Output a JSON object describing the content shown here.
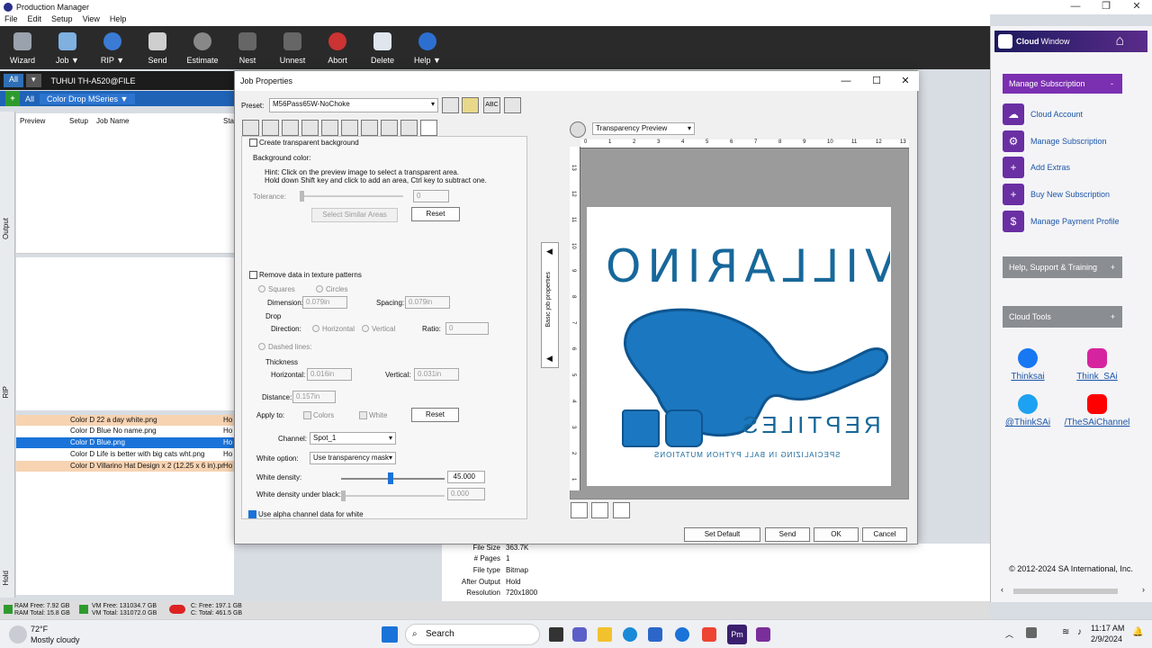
{
  "app": {
    "title": "Production Manager",
    "window_controls": {
      "minimize": "—",
      "maximize": "❐",
      "close": "✕"
    }
  },
  "menu": [
    "File",
    "Edit",
    "Setup",
    "View",
    "Help"
  ],
  "toolbar": [
    {
      "label": "Wizard",
      "icon": "wizard-icon"
    },
    {
      "label": "Job ▼",
      "icon": "job-folder-icon"
    },
    {
      "label": "RIP ▼",
      "icon": "rip-globe-icon"
    },
    {
      "label": "Send",
      "icon": "printer-icon"
    },
    {
      "label": "Estimate",
      "icon": "estimate-icon"
    },
    {
      "label": "Nest",
      "icon": "nest-icon"
    },
    {
      "label": "Unnest",
      "icon": "unnest-icon"
    },
    {
      "label": "Abort",
      "icon": "abort-icon"
    },
    {
      "label": "Delete",
      "icon": "delete-icon"
    },
    {
      "label": "Help ▼",
      "icon": "help-icon"
    }
  ],
  "queue": {
    "all_tab": "All",
    "device": "TUHUI TH-A520@FILE",
    "filter_all": "All",
    "filter_drop": "Color Drop MSeries ▼"
  },
  "list_headers": {
    "preview": "Preview",
    "setup": "Setup",
    "job_name": "Job Name",
    "status": "Sta"
  },
  "side_labels": {
    "output": "Output",
    "rip": "RIP",
    "hold": "Hold"
  },
  "hold_jobs": [
    {
      "setup": "Color D",
      "name": "22 a day white.png",
      "status": "Ho",
      "style": "orange"
    },
    {
      "setup": "Color D",
      "name": "Blue No name.png",
      "status": "Ho",
      "style": "plain"
    },
    {
      "setup": "Color D",
      "name": "Blue.png",
      "status": "Ho",
      "style": "selected"
    },
    {
      "setup": "Color D",
      "name": "Life is better with big cats wht.png",
      "status": "Ho",
      "style": "plain"
    },
    {
      "setup": "Color D",
      "name": "Villarino Hat Design x 2 (12.25 x 6 in).pr",
      "status": "Ho",
      "style": "orange"
    }
  ],
  "details": [
    {
      "k": "File Size",
      "v": "363.7K"
    },
    {
      "k": "# Pages",
      "v": "1"
    },
    {
      "k": "File type",
      "v": "Bitmap"
    },
    {
      "k": "After Output",
      "v": "Hold"
    },
    {
      "k": "Resolution",
      "v": "720x1800"
    }
  ],
  "status": {
    "ram_free": "RAM Free: 7.92 GB",
    "ram_total": "RAM Total: 15.8 GB",
    "vm_free": "VM Free: 131034.7 GB",
    "vm_total": "VM Total: 131072.0 GB",
    "c_free": "C: Free: 197.1 GB",
    "c_total": "C: Total: 461.5 GB"
  },
  "dialog": {
    "title": "Job Properties",
    "preset_label": "Preset:",
    "preset_value": "M56Pass65W-NoChoke",
    "create_transparent": "Create transparent background",
    "bg_color_label": "Background color:",
    "hint": "Hint: Click on the preview image to select a transparent area.",
    "hint2": "Hold down Shift key and click to add an area, Ctrl key to subtract one.",
    "tolerance_label": "Tolerance:",
    "tolerance_value": "0",
    "select_similar": "Select Similar Areas",
    "reset": "Reset",
    "remove_texture": "Remove data in texture patterns",
    "squares": "Squares",
    "circles": "Circles",
    "dimension_label": "Dimension:",
    "dimension_value": "0.079in",
    "spacing_label": "Spacing:",
    "spacing_value": "0.079in",
    "drop_label": "Drop",
    "direction_label": "Direction:",
    "horizontal": "Horizontal",
    "vertical": "Vertical",
    "ratio_label": "Ratio:",
    "ratio_value": "0",
    "dashed_lines": "Dashed lines:",
    "thickness_label": "Thickness",
    "thick_h_label": "Horizontal:",
    "thick_h_value": "0.016in",
    "thick_v_label": "Vertical:",
    "thick_v_value": "0.031in",
    "distance_label": "Distance:",
    "distance_value": "0.157in",
    "apply_to": "Apply to:",
    "colors": "Colors",
    "white": "White",
    "reset2": "Reset",
    "channel_label": "Channel:",
    "channel_value": "Spot_1",
    "white_option_label": "White option:",
    "white_option_value": "Use transparency mask",
    "white_density_label": "White density:",
    "white_density_value": "45.000",
    "white_density_fraction": 0.45,
    "white_under_black_label": "White density under black:",
    "white_under_black_value": "0.000",
    "use_alpha": "Use alpha channel data for white",
    "basic_props": "Basic job properties",
    "preview_mode": "Transparency Preview",
    "ruler_ticks": [
      "0",
      "1",
      "2",
      "3",
      "4",
      "5",
      "6",
      "7",
      "8",
      "9",
      "10",
      "11",
      "12",
      "13"
    ],
    "ruler_left_ticks": [
      "13",
      "12",
      "11",
      "10",
      "9",
      "8",
      "7",
      "6",
      "5",
      "4",
      "3",
      "2",
      "1"
    ],
    "buttons": {
      "set_default": "Set Default",
      "send": "Send",
      "ok": "OK",
      "cancel": "Cancel"
    },
    "art": {
      "title": "VILLARINO",
      "sub": "REPTILES",
      "tag": "SPECIALIZING IN BALL PYTHON MUTATIONS"
    }
  },
  "cloud": {
    "header_title": "Cloud",
    "header_sub": "Window",
    "manage_sub": "Manage Subscription",
    "links": [
      {
        "label": "Cloud Account",
        "icon": "cloud-account-icon"
      },
      {
        "label": "Manage Subscription",
        "icon": "manage-subscription-icon"
      },
      {
        "label": "Add Extras",
        "icon": "add-extras-icon"
      },
      {
        "label": "Buy New Subscription",
        "icon": "buy-subscription-icon"
      },
      {
        "label": "Manage Payment Profile",
        "icon": "payment-profile-icon"
      }
    ],
    "help_section": "Help, Support & Training",
    "tools_section": "Cloud Tools",
    "social": [
      {
        "label": "Thinksai",
        "icon": "facebook-icon",
        "color": "#1877f2"
      },
      {
        "label": "Think_SAi",
        "icon": "instagram-icon",
        "color": "#d6249f"
      },
      {
        "label": "@ThinkSAi",
        "icon": "twitter-icon",
        "color": "#1da1f2"
      },
      {
        "label": "/TheSAiChannel",
        "icon": "youtube-icon",
        "color": "#ff0000"
      }
    ],
    "copyright": "© 2012-2024 SA International, Inc."
  },
  "taskbar": {
    "weather_temp": "72°F",
    "weather_desc": "Mostly cloudy",
    "search_placeholder": "Search",
    "time": "11:17 AM",
    "date": "2/9/2024"
  }
}
